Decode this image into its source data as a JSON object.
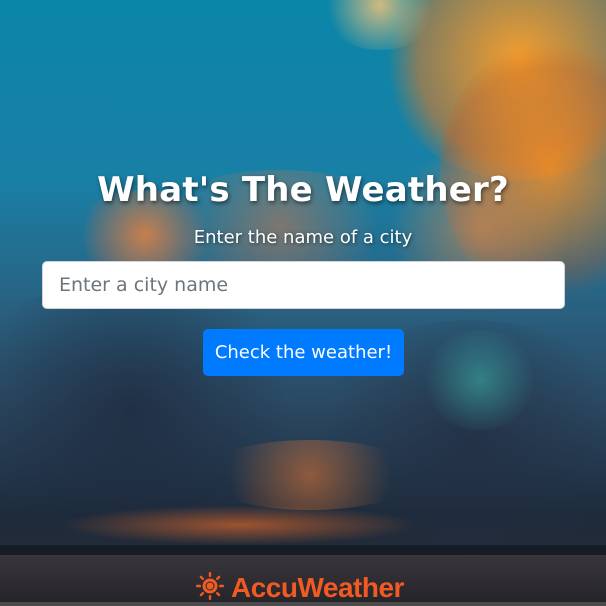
{
  "page": {
    "title": "What's The Weather?",
    "subtitle": "Enter the name of a city"
  },
  "search": {
    "placeholder": "Enter a city name",
    "value": ""
  },
  "actions": {
    "check_label": "Check the weather!"
  },
  "branding": {
    "logo_text": "AccuWeather",
    "logo_icon": "sun-icon",
    "logo_color": "#f15a22"
  },
  "colors": {
    "button_bg": "#007bff",
    "title_text": "#ffffff"
  }
}
